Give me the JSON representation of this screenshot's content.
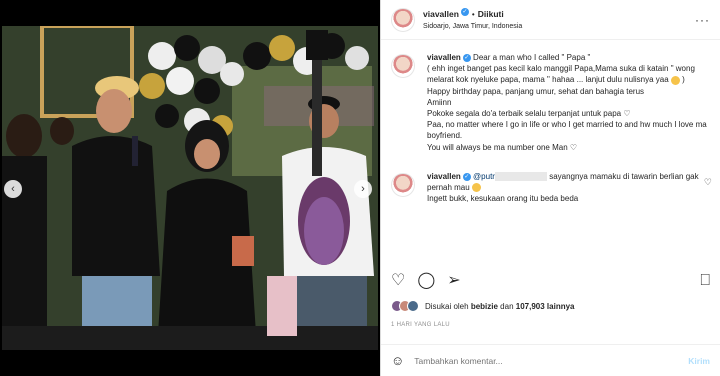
{
  "header": {
    "username": "viavallen",
    "follow_label": "Diikuti",
    "location": "Sidoarjo, Jawa Timur, Indonesia",
    "more_icon": "more-icon"
  },
  "caption": {
    "username": "viavallen",
    "lines": [
      "Dear a man who I called \" Papa \"",
      "( ehh inget banget pas kecil kalo manggil Papa,Mama suka di katain \" wong melarat kok nyeluke papa, mama \" hahaa ... lanjut dulu nulisnya yaa",
      "Happy birthday papa, panjang umur, sehat dan bahagia terus",
      "Amiinn",
      "Pokoke segala do'a terbaik selalu terpanjat untuk papa",
      "Paa, no matter where I go in life or who I get married to and hw much I love ma boyfriend.",
      "You will always be ma number one Man"
    ],
    "emoji_after_line2": ")"
  },
  "comment": {
    "username": "viavallen",
    "mention": "@putr",
    "text": "sayangnya mamaku di tawarin berlian gak pernah mau",
    "text2": "Ingett bukk, kesukaan orang itu beda beda"
  },
  "likes": {
    "prefix": "Disukai oleh",
    "user": "bebizie",
    "joiner": "dan",
    "count": "107,903",
    "suffix": "lainnya"
  },
  "date": "1 HARI YANG LALU",
  "add_comment": {
    "placeholder": "Tambahkan komentar...",
    "post_label": "Kirim"
  },
  "colors": {
    "verified": "#3897f0",
    "post_disabled": "#b2dffc",
    "mention": "#00376b"
  }
}
